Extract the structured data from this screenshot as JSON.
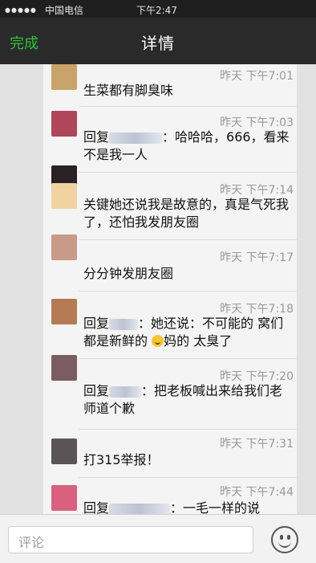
{
  "status_bar": {
    "carrier": "中国电信",
    "time": "下午2:47"
  },
  "nav": {
    "done_label": "完成",
    "title": "详情"
  },
  "comments": [
    {
      "time": "昨天 下午7:01",
      "text": "生菜都有脚臭味",
      "avatar": "#c9a36a"
    },
    {
      "time": "昨天 下午7:03",
      "reply_prefix": "回复",
      "reply_suffix": "：哈哈哈，666，看来不是我一人",
      "avatar": "#b0465a"
    },
    {
      "time": "昨天 下午7:14",
      "text": "关键她还说我是故意的，真是气死我了，还怕我发朋友圈",
      "avatar": "#2a2125"
    },
    {
      "time": "昨天 下午7:17",
      "text": "分分钟发朋友圈",
      "avatar": "#c89a88"
    },
    {
      "time": "昨天 下午7:18",
      "reply_prefix": "回复",
      "reply_suffix_before_emoji": "：她还说：不可能的 窝们都是新鲜的",
      "reply_suffix_after_emoji": "妈的 太臭了",
      "avatar": "#b57b55"
    },
    {
      "time": "昨天 下午7:20",
      "reply_prefix": "回复",
      "reply_suffix": "：把老板喊出来给我们老师道个歉",
      "avatar": "#7b5c61"
    },
    {
      "time": "昨天 下午7:31",
      "text": "打315举报！",
      "avatar": "#5b5457"
    },
    {
      "time": "昨天 下午7:44",
      "reply_prefix": "回复",
      "reply_suffix": "：一毛一样的说",
      "avatar": "#d9607e"
    }
  ],
  "input": {
    "placeholder": "评论"
  },
  "icons": {
    "emoji_button": "smiley-icon"
  },
  "colors": {
    "done_green": "#2fc235",
    "nav_bg": "#2a2a2b"
  }
}
